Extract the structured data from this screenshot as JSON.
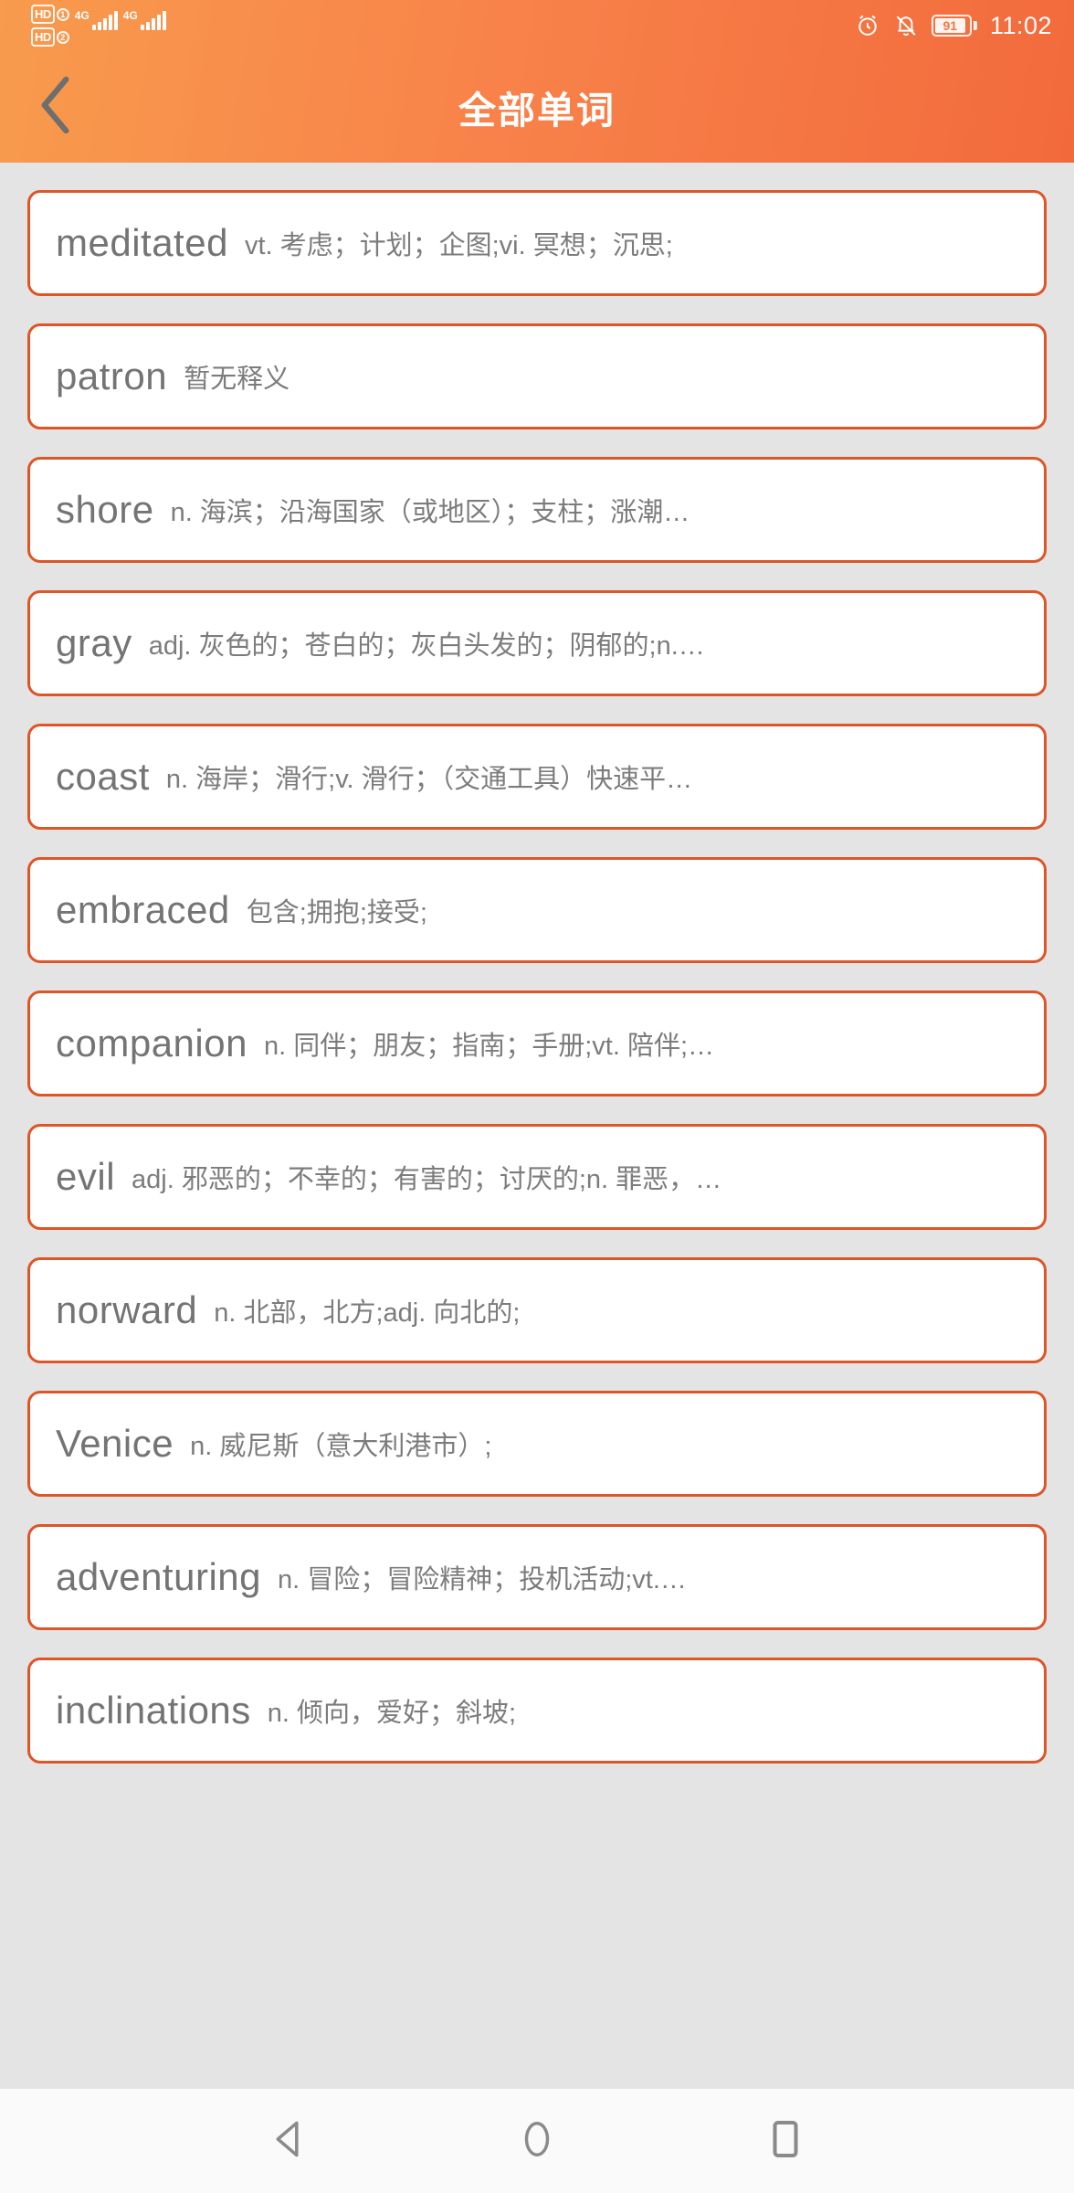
{
  "statusbar": {
    "hd1_label": "HD",
    "hd1_sim": "1",
    "hd2_label": "HD",
    "hd2_sim": "2",
    "network_1": "4G",
    "network_2": "4G",
    "alarm_icon": "alarm-clock-icon",
    "mute_icon": "bell-muted-icon",
    "battery_percent": "91",
    "time": "11:02"
  },
  "appbar": {
    "back_icon": "back-chevron-icon",
    "title": "全部单词"
  },
  "colors": {
    "header_start": "#f89b4d",
    "header_end": "#f26a3c",
    "card_border": "#de5527",
    "page_bg": "#e4e4e4",
    "word_text": "#747474",
    "meaning_text": "#7c7c7c"
  },
  "list": {
    "items": [
      {
        "word": "meditated",
        "meaning": "vt. 考虑；计划；企图;vi. 冥想；沉思;"
      },
      {
        "word": "patron",
        "meaning": "暂无释义"
      },
      {
        "word": "shore",
        "meaning": "n. 海滨；沿海国家（或地区）；支柱；涨潮…"
      },
      {
        "word": "gray",
        "meaning": "adj. 灰色的；苍白的；灰白头发的；阴郁的;n.…"
      },
      {
        "word": "coast",
        "meaning": "n. 海岸；滑行;v. 滑行；（交通工具）快速平…"
      },
      {
        "word": "embraced",
        "meaning": "包含;拥抱;接受;"
      },
      {
        "word": "companion",
        "meaning": "n. 同伴；朋友；指南；手册;vt. 陪伴;…"
      },
      {
        "word": "evil",
        "meaning": "adj. 邪恶的；不幸的；有害的；讨厌的;n. 罪恶，…"
      },
      {
        "word": "norward",
        "meaning": "n. 北部，北方;adj. 向北的;"
      },
      {
        "word": "Venice",
        "meaning": "n. 威尼斯（意大利港市）;"
      },
      {
        "word": "adventuring",
        "meaning": "n. 冒险；冒险精神；投机活动;vt.…"
      },
      {
        "word": "inclinations",
        "meaning": "n. 倾向，爱好；斜坡;"
      }
    ]
  },
  "navbar": {
    "back_icon": "nav-back-triangle-icon",
    "home_icon": "nav-home-circle-icon",
    "recents_icon": "nav-recents-square-icon"
  }
}
